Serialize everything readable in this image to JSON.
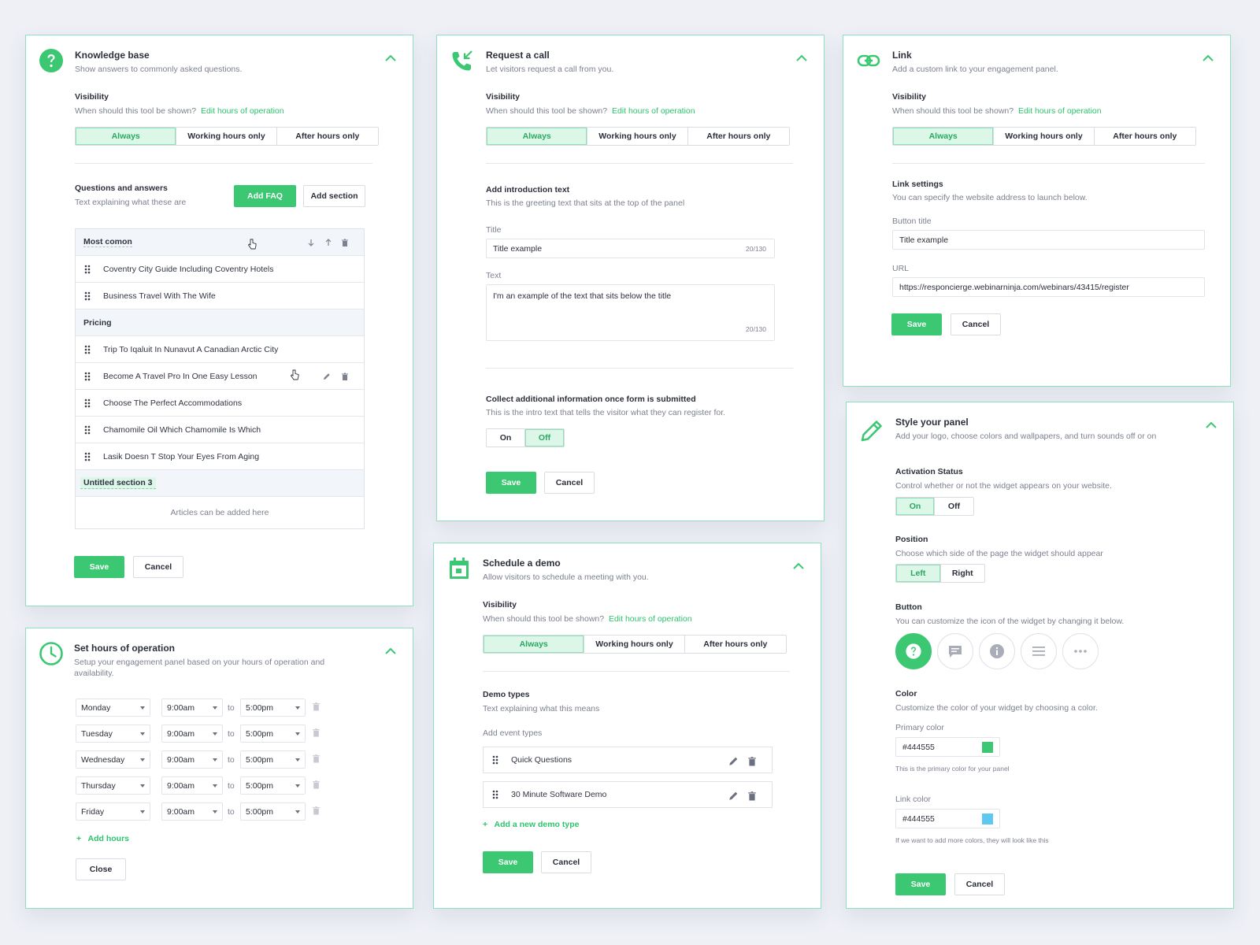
{
  "kb": {
    "title": "Knowledge base",
    "subtitle": "Show answers to commonly asked questions.",
    "visibility_label": "Visibility",
    "visibility_q": "When should this tool be shown?",
    "edit_hours": "Edit hours of operation",
    "vis_options": [
      "Always",
      "Working hours only",
      "After hours only"
    ],
    "qa_label": "Questions and answers",
    "qa_sub": "Text explaining what these are",
    "add_faq": "Add FAQ",
    "add_section": "Add section",
    "section1": "Most comon",
    "items1": [
      "Coventry City Guide Including Coventry Hotels",
      "Business Travel With The Wife"
    ],
    "section2": "Pricing",
    "items2": [
      "Trip To Iqaluit In Nunavut A Canadian Arctic City",
      "Become A Travel Pro In One Easy Lesson",
      "Choose The Perfect Accommodations",
      "Chamomile Oil Which Chamomile Is Which",
      "Lasik Doesn T Stop Your Eyes From Aging"
    ],
    "section3": "Untitled section 3",
    "empty_hint": "Articles can be added here",
    "save": "Save",
    "cancel": "Cancel"
  },
  "hours": {
    "title": "Set hours of operation",
    "subtitle_line1": "Setup your engagement panel based on your hours of operation and",
    "subtitle_line2": "availability.",
    "rows": [
      {
        "day": "Monday",
        "from": "9:00am",
        "to_word": "to",
        "to": "5:00pm"
      },
      {
        "day": "Tuesday",
        "from": "9:00am",
        "to_word": "to",
        "to": "5:00pm"
      },
      {
        "day": "Wednesday",
        "from": "9:00am",
        "to_word": "to",
        "to": "5:00pm"
      },
      {
        "day": "Thursday",
        "from": "9:00am",
        "to_word": "to",
        "to": "5:00pm"
      },
      {
        "day": "Friday",
        "from": "9:00am",
        "to_word": "to",
        "to": "5:00pm"
      }
    ],
    "add_hours": "Add hours",
    "close": "Close"
  },
  "call": {
    "title": "Request a call",
    "subtitle": "Let visitors request a call from you.",
    "visibility_label": "Visibility",
    "visibility_q": "When should this tool be shown?",
    "edit_hours": "Edit hours of operation",
    "vis_options": [
      "Always",
      "Working hours only",
      "After hours only"
    ],
    "intro_label": "Add introduction text",
    "intro_sub": "This is the greeting text that sits at the top of the panel",
    "title_label": "Title",
    "title_value": "Title example",
    "title_count": "20/130",
    "text_label": "Text",
    "text_value": "I'm an example of the text that sits below the title",
    "text_count": "20/130",
    "collect_label": "Collect additional information once form is submitted",
    "collect_sub": "This is the intro text that tells the visitor what they can register for.",
    "toggle": [
      "On",
      "Off"
    ],
    "save": "Save",
    "cancel": "Cancel"
  },
  "demo": {
    "title": "Schedule a demo",
    "subtitle": "Allow visitors to schedule a meeting with you.",
    "visibility_label": "Visibility",
    "visibility_q": "When should this tool be shown?",
    "edit_hours": "Edit hours of operation",
    "vis_options": [
      "Always",
      "Working hours only",
      "After hours only"
    ],
    "types_label": "Demo types",
    "types_sub": "Text explaining what this means",
    "add_event": "Add event types",
    "types": [
      "Quick Questions",
      "30 Minute Software Demo"
    ],
    "add_new": "Add a new demo type",
    "save": "Save",
    "cancel": "Cancel"
  },
  "link": {
    "title": "Link",
    "subtitle": "Add a custom link to your engagement panel.",
    "visibility_label": "Visibility",
    "visibility_q": "When should this tool be shown?",
    "edit_hours": "Edit hours of operation",
    "vis_options": [
      "Always",
      "Working hours only",
      "After hours only"
    ],
    "settings_label": "Link settings",
    "settings_sub": "You can specify the website address to launch below.",
    "btn_title_label": "Button title",
    "btn_title_value": "Title example",
    "url_label": "URL",
    "url_value": "https://responcierge.webinarninja.com/webinars/43415/register",
    "save": "Save",
    "cancel": "Cancel"
  },
  "style": {
    "title": "Style your panel",
    "subtitle": "Add your logo, choose colors and wallpapers, and turn sounds off or on",
    "activation_label": "Activation Status",
    "activation_sub": "Control whether or not the widget appears on your website.",
    "activation_opts": [
      "On",
      "Off"
    ],
    "position_label": "Position",
    "position_sub": "Choose which side of the page the widget should appear",
    "position_opts": [
      "Left",
      "Right"
    ],
    "button_label": "Button",
    "button_sub": "You can customize the icon of the widget by changing it below.",
    "color_label": "Color",
    "color_sub": "Customize the color of your widget by choosing a color.",
    "primary_label": "Primary color",
    "primary_value": "#444555",
    "primary_hint": "This is the primary color for your panel",
    "primary_swatch": "#3cc873",
    "link_label": "Link color",
    "link_value": "#444555",
    "link_hint": "If we want to add more colors, they will look like this",
    "link_swatch": "#5ec8f0",
    "save": "Save",
    "cancel": "Cancel"
  },
  "colors": {
    "accent": "#3cc873",
    "border": "#8fe0c0",
    "text": "#2b2f3a"
  }
}
